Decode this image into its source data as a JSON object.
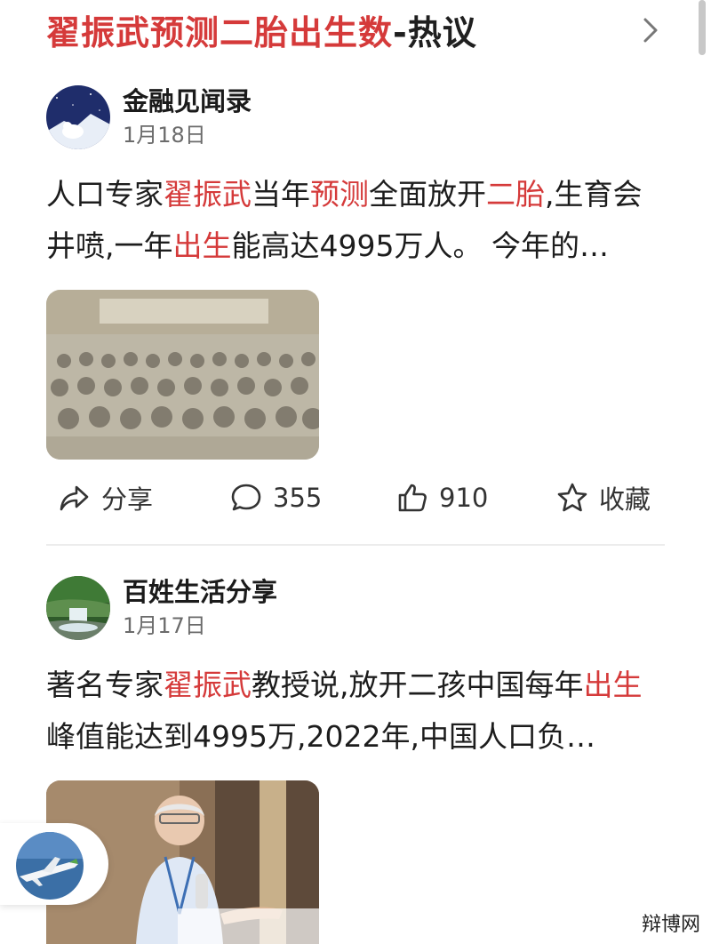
{
  "header": {
    "title_part1": "翟振武预测二胎出生数",
    "title_part2": "-热议"
  },
  "posts": [
    {
      "author": "金融见闻录",
      "date": "1月18日",
      "text_segments": [
        {
          "text": "人口专家",
          "highlight": false
        },
        {
          "text": "翟振武",
          "highlight": true
        },
        {
          "text": "当年",
          "highlight": false
        },
        {
          "text": "预测",
          "highlight": true
        },
        {
          "text": "全面放开",
          "highlight": false
        },
        {
          "text": "二胎",
          "highlight": true
        },
        {
          "text": ",生育会井喷,一年",
          "highlight": false
        },
        {
          "text": "出生",
          "highlight": true
        },
        {
          "text": "能高达4995万人。 今年的…",
          "highlight": false
        }
      ]
    },
    {
      "author": "百姓生活分享",
      "date": "1月17日",
      "text_segments": [
        {
          "text": "著名专家",
          "highlight": false
        },
        {
          "text": "翟振武",
          "highlight": true
        },
        {
          "text": "教授说,放开二孩中国每年",
          "highlight": false
        },
        {
          "text": "出生",
          "highlight": true
        },
        {
          "text": "峰值能达到4995万,2022年,中国人口负…",
          "highlight": false
        }
      ]
    }
  ],
  "actions": {
    "share_label": "分享",
    "comment_count": "355",
    "like_count": "910",
    "favorite_label": "收藏"
  },
  "watermark": "辩博网",
  "colors": {
    "highlight": "#d53a3a",
    "text": "#1d1d1d",
    "secondary": "#6b6b6b"
  }
}
